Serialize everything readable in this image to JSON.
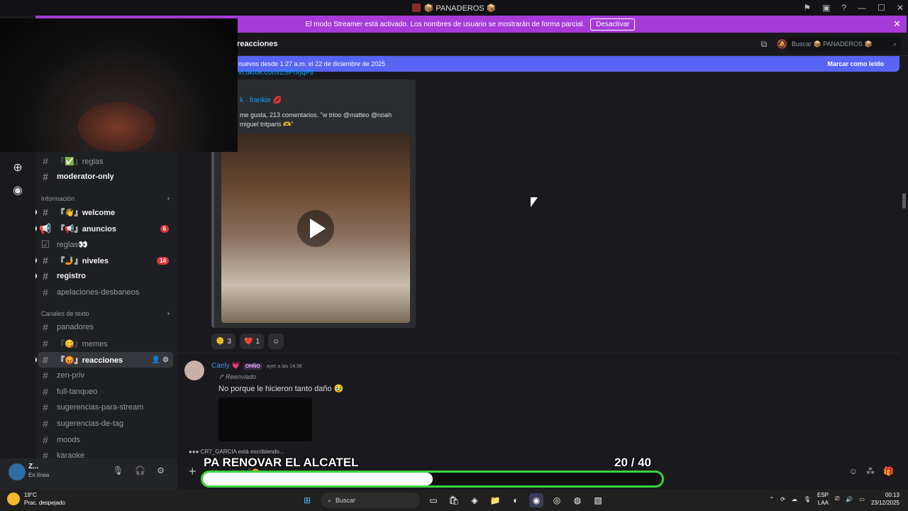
{
  "window": {
    "title": "📦 PANADEROS 📦"
  },
  "streamer_banner": {
    "text": "El modo Streamer está activado. Los nombres de usuario se mostrarán de forma parcial.",
    "button": "Desactivar"
  },
  "sidebar": {
    "channels": [
      {
        "name": "『✅』reglas",
        "style": "muted"
      },
      {
        "name": "moderator-only",
        "style": "bold"
      }
    ],
    "cat_info": "Información",
    "info_channels": [
      {
        "name": "『👋』welcome",
        "style": "bold",
        "badge": ""
      },
      {
        "name": "『📢』anuncios",
        "style": "bold",
        "badge": "6"
      },
      {
        "name": "reglas👀",
        "style": "muted",
        "badge": ""
      },
      {
        "name": "『🤳』niveles",
        "style": "bold",
        "badge": "14"
      },
      {
        "name": "registro",
        "style": "bold",
        "badge": ""
      },
      {
        "name": "apelaciones-desbaneos",
        "style": "muted",
        "badge": ""
      }
    ],
    "cat_text": "Canales de texto",
    "text_channels": [
      {
        "name": "panadores",
        "style": "muted"
      },
      {
        "name": "『😋』memes",
        "style": "muted"
      },
      {
        "name": "『😡』reacciones",
        "style": "selected"
      },
      {
        "name": "zen-priv",
        "style": "muted"
      },
      {
        "name": "full-tanqueo",
        "style": "muted"
      },
      {
        "name": "sugerencias-para-stream",
        "style": "muted"
      },
      {
        "name": "sugerencias-de-tag",
        "style": "muted"
      },
      {
        "name": "moods",
        "style": "muted"
      },
      {
        "name": "karaoke",
        "style": "muted"
      }
    ]
  },
  "header": {
    "channel": "reacciones",
    "search_placeholder": "Buscar 📦 PANADEROS 📦"
  },
  "new_messages": {
    "text": "nuevos desde 1:27 a.m. el 22 de diciembre de 2025",
    "action": "Marcar como leído"
  },
  "message1": {
    "link": "vt.tiktok.com/ZSPhrjqPt/",
    "embed_author": "k · frankie 💋",
    "embed_desc": "me gusta, 213 comentarios. \"w trioo @matteo @noah miguel tntparis 🫶\"",
    "reactions": [
      {
        "emoji": "🫠",
        "count": "3"
      },
      {
        "emoji": "❤️",
        "count": "1"
      }
    ]
  },
  "message2": {
    "author": "Caely 💗",
    "tag": "OHÑO",
    "timestamp": "ayer a las 14:38",
    "forwarded": "Reenviado",
    "text": "No porque le hicieron tanto daño 🥹"
  },
  "typing": "CR7_GARCIA está escribiendo...",
  "user": {
    "name": "Z...",
    "status": "En línea"
  },
  "composer": {
    "placeholder": "Mensaje #『😡』reacciones"
  },
  "overlay": {
    "label": "PA RENOVAR EL ALCATEL",
    "count": "20  / 40",
    "progress": 0.5
  },
  "taskbar": {
    "weather_temp": "19°C",
    "weather_desc": "Prac. despejado",
    "search": "Buscar",
    "lang1": "ESP",
    "lang2": "LAA",
    "time": "00:13",
    "date": "23/12/2025"
  }
}
